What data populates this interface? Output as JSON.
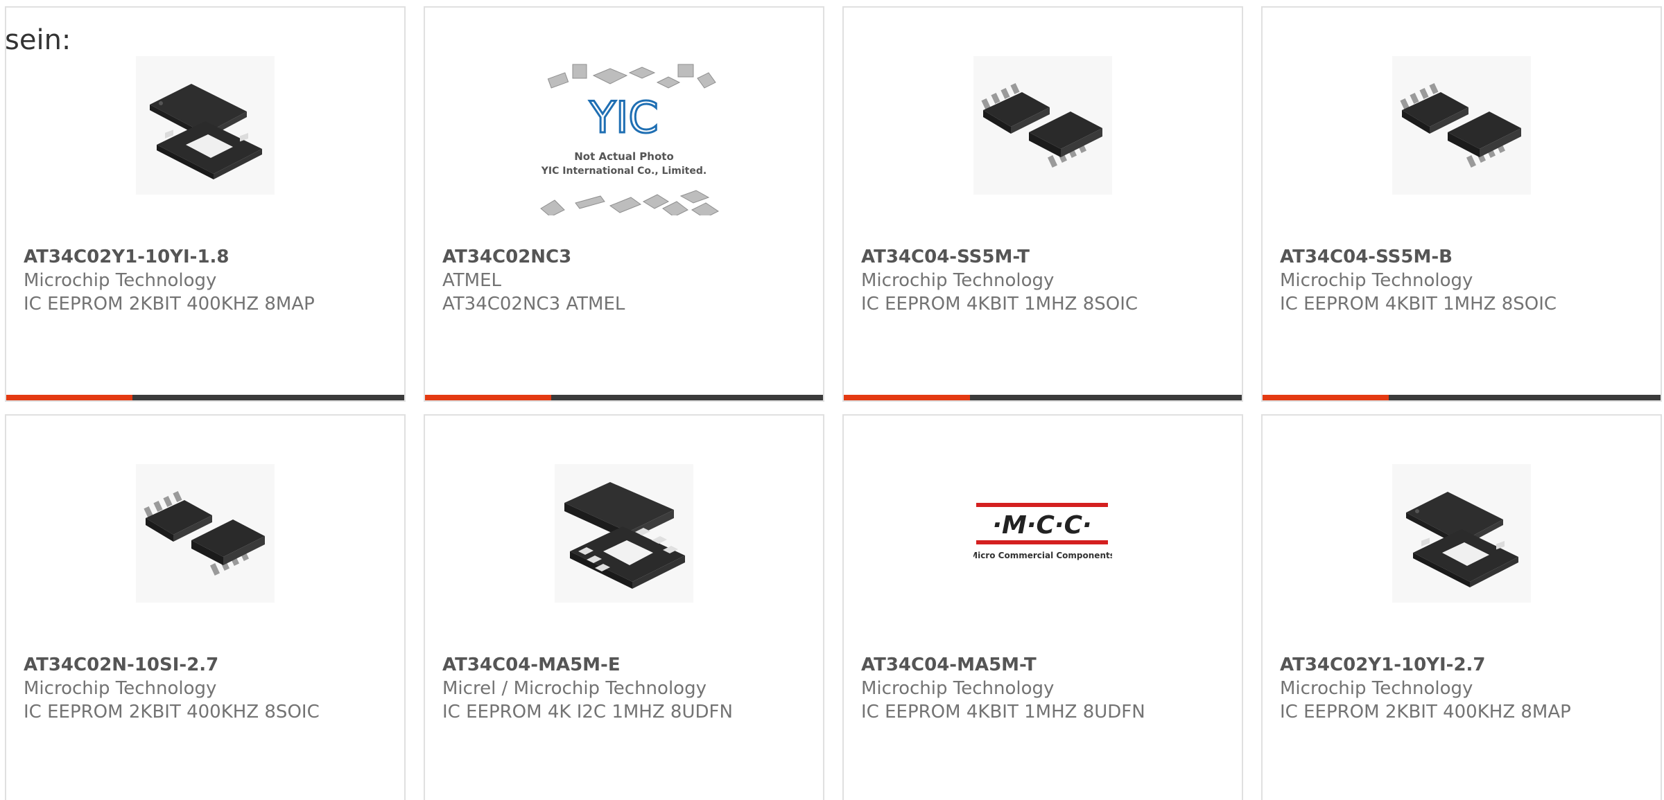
{
  "intro_text": "sein:",
  "colors": {
    "accent": "#e43a12",
    "bar": "#3b3b3b",
    "border": "#e0e0e0"
  },
  "products": [
    {
      "part_number": "AT34C02Y1-10YI-1.8",
      "manufacturer": "Microchip Technology",
      "description": "IC EEPROM 2KBIT 400KHZ 8MAP",
      "image": "map-package-icon"
    },
    {
      "part_number": "AT34C02NC3",
      "manufacturer": "ATMEL",
      "description": "AT34C02NC3 ATMEL",
      "image": "placeholder-photo",
      "placeholder_logo": "YIC",
      "placeholder_caption": "Not Actual Photo",
      "placeholder_company": "YIC International Co., Limited."
    },
    {
      "part_number": "AT34C04-SS5M-T",
      "manufacturer": "Microchip Technology",
      "description": "IC EEPROM 4KBIT 1MHZ 8SOIC",
      "image": "soic-package-icon"
    },
    {
      "part_number": "AT34C04-SS5M-B",
      "manufacturer": "Microchip Technology",
      "description": "IC EEPROM 4KBIT 1MHZ 8SOIC",
      "image": "soic-package-icon"
    },
    {
      "part_number": "AT34C02N-10SI-2.7",
      "manufacturer": "Microchip Technology",
      "description": "IC EEPROM 2KBIT 400KHZ 8SOIC",
      "image": "soic-package-icon"
    },
    {
      "part_number": "AT34C04-MA5M-E",
      "manufacturer": "Micrel / Microchip Technology",
      "description": "IC EEPROM 4K I2C 1MHZ 8UDFN",
      "image": "udfn-package-icon"
    },
    {
      "part_number": "AT34C04-MA5M-T",
      "manufacturer": "Microchip Technology",
      "description": "IC EEPROM 4KBIT 1MHZ 8UDFN",
      "image": "mcc-logo",
      "logo_text": "·M·C·C·",
      "logo_caption": "Micro Commercial Components"
    },
    {
      "part_number": "AT34C02Y1-10YI-2.7",
      "manufacturer": "Microchip Technology",
      "description": "IC EEPROM 2KBIT 400KHZ 8MAP",
      "image": "map-package-icon"
    }
  ]
}
